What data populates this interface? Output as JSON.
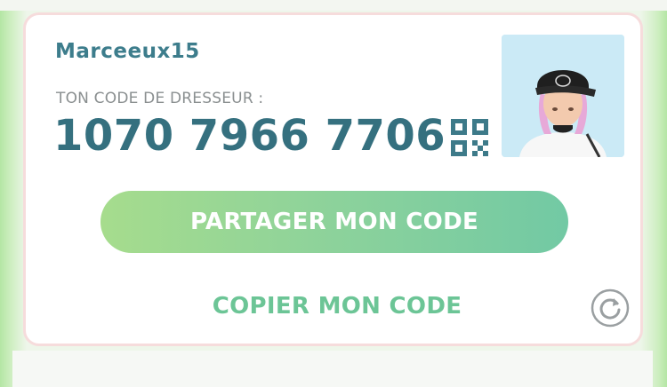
{
  "profile": {
    "username": "Marceeux15"
  },
  "trainer_code": {
    "label": "TON CODE DE DRESSEUR :",
    "value": "1070 7966 7706"
  },
  "actions": {
    "share_label": "PARTAGER MON CODE",
    "copy_label": "COPIER MON CODE"
  },
  "icons": {
    "qr": "qr-code-icon",
    "refresh": "refresh-icon",
    "avatar": "trainer-avatar"
  },
  "colors": {
    "username": "#3d7d8c",
    "code": "#35707f",
    "share_gradient_start": "#a6dc8d",
    "share_gradient_end": "#72c9a4",
    "copy_text": "#6cc596",
    "card_border": "#f6dcdc"
  }
}
